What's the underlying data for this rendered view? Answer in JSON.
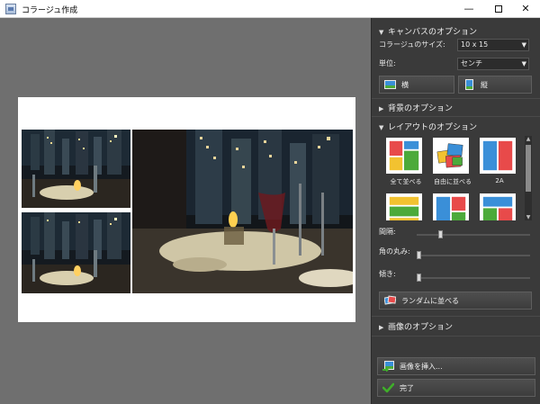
{
  "window": {
    "title": "コラージュ作成",
    "minimize": "—",
    "close": "✕"
  },
  "canvas_options": {
    "header": "キャンバスのオプション",
    "size_label": "コラージュのサイズ:",
    "size_value": "10 x 15",
    "unit_label": "単位:",
    "unit_value": "センチ",
    "landscape_label": "横",
    "portrait_label": "縦"
  },
  "background_options": {
    "header": "背景のオプション"
  },
  "layout_options": {
    "header": "レイアウトのオプション",
    "layouts": [
      {
        "caption": "全て並べる"
      },
      {
        "caption": "自由に並べる"
      },
      {
        "caption": "2A"
      },
      {
        "caption": ""
      },
      {
        "caption": ""
      },
      {
        "caption": ""
      }
    ],
    "spacing_label": "間隔:",
    "spacing_value": 0.2,
    "rounding_label": "角の丸み:",
    "rounding_value": 0.0,
    "tilt_label": "傾き:",
    "tilt_value": 0.0,
    "random_button": "ランダムに並べる"
  },
  "image_options": {
    "header": "画像のオプション"
  },
  "actions": {
    "insert_image": "画像を挿入...",
    "done": "完了"
  },
  "colors": {
    "panel_bg": "#3a3a3a",
    "canvas_bg": "#6f6f6f",
    "accent_check": "#3fae2a"
  }
}
